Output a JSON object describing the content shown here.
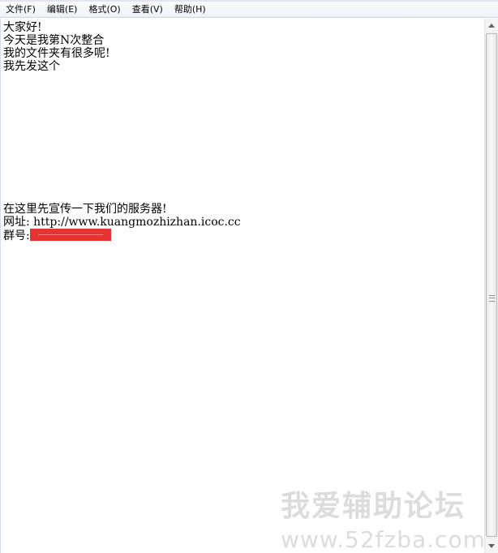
{
  "menu": {
    "items": [
      "文件(F)",
      "编辑(E)",
      "格式(O)",
      "查看(V)",
      "帮助(H)"
    ]
  },
  "editor": {
    "lines": [
      "大家好!",
      "今天是我第N次整合",
      "我的文件夹有很多呢!",
      "我先发这个",
      "在这里先宣传一下我们的服务器!",
      "网址: http://www.kuangmozhizhan.icoc.cc",
      "群号:"
    ]
  },
  "watermark": {
    "title": "我爱辅助论坛",
    "url": "www.52fzba.com"
  },
  "colors": {
    "redaction": "#e53232",
    "watermark": "#dcdcdc",
    "menubar": "#eef2f8"
  },
  "icons": {
    "scroll_up": "triangle-up",
    "scroll_down": "triangle-down"
  }
}
